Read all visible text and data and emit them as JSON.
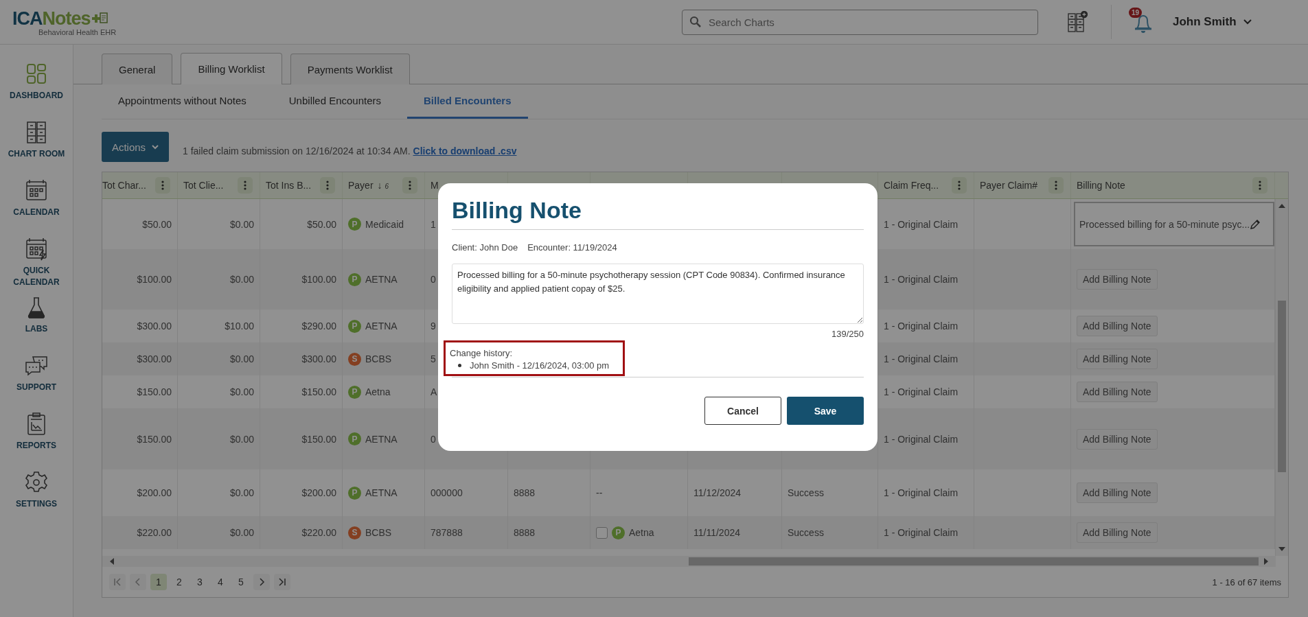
{
  "header": {
    "logo": {
      "main": "ICA",
      "accent": "Notes",
      "tagline": "Behavioral Health EHR"
    },
    "search": {
      "placeholder": "Search Charts"
    },
    "notifications": {
      "count": "19"
    },
    "user": {
      "name": "John Smith"
    }
  },
  "sidebar": {
    "items": [
      {
        "label": "DASHBOARD",
        "selected": true
      },
      {
        "label": "CHART ROOM",
        "selected": false
      },
      {
        "label": "CALENDAR",
        "selected": false
      },
      {
        "label": "QUICK CALENDAR",
        "selected": false
      },
      {
        "label": "LABS",
        "selected": false
      },
      {
        "label": "SUPPORT",
        "selected": false
      },
      {
        "label": "REPORTS",
        "selected": false
      },
      {
        "label": "SETTINGS",
        "selected": false
      }
    ]
  },
  "tabs": [
    {
      "label": "General",
      "selected": false
    },
    {
      "label": "Billing Worklist",
      "selected": true
    },
    {
      "label": "Payments Worklist",
      "selected": false
    }
  ],
  "subtabs": [
    {
      "label": "Appointments without Notes",
      "selected": false
    },
    {
      "label": "Unbilled Encounters",
      "selected": false
    },
    {
      "label": "Billed Encounters",
      "selected": true
    }
  ],
  "toolbar": {
    "actions": "Actions",
    "message": "1 failed claim submission on 12/16/2024 at 10:34 AM.",
    "link": "Click to download .csv"
  },
  "table": {
    "columns": [
      {
        "label": "Tot Char...",
        "menu": true
      },
      {
        "label": "Tot Clie...",
        "menu": true
      },
      {
        "label": "Tot Ins B...",
        "menu": true
      },
      {
        "label": "Payer",
        "sort": "↓",
        "sort_index": "6",
        "menu": true
      },
      {
        "label": "M",
        "menu": false
      },
      {
        "menu": false
      },
      {
        "menu": false
      },
      {
        "menu": false
      },
      {
        "menu": false
      },
      {
        "label": "Claim Freq...",
        "menu": true
      },
      {
        "label": "Payer Claim#",
        "menu": true
      },
      {
        "label": "Billing Note",
        "menu": true
      }
    ],
    "rows": [
      {
        "tot_charge": "$50.00",
        "tot_client": "$0.00",
        "tot_ins": "$50.00",
        "payer": {
          "badge": "P",
          "name": "Medicaid",
          "kind": "primary"
        },
        "column_5": "1",
        "claim_frequency": "1 - Original Claim",
        "billing_note": {
          "kind": "note",
          "text": "Processed billing for a 50-minute psyc...",
          "selected": true
        }
      },
      {
        "tot_charge": "$100.00",
        "tot_client": "$0.00",
        "tot_ins": "$100.00",
        "payer": {
          "badge": "P",
          "name": "AETNA",
          "kind": "primary"
        },
        "column_5": "0",
        "claim_frequency": "1 - Original Claim",
        "billing_note": {
          "kind": "add",
          "text": "Add Billing Note",
          "selected": false
        }
      },
      {
        "tot_charge": "$300.00",
        "tot_client": "$10.00",
        "tot_ins": "$290.00",
        "payer": {
          "badge": "P",
          "name": "AETNA",
          "kind": "primary"
        },
        "column_5": "9",
        "claim_frequency": "1 - Original Claim",
        "billing_note": {
          "kind": "add",
          "text": "Add Billing Note",
          "selected": false
        }
      },
      {
        "tot_charge": "$300.00",
        "tot_client": "$0.00",
        "tot_ins": "$300.00",
        "payer": {
          "badge": "S",
          "name": "BCBS",
          "kind": "secondary"
        },
        "column_5": "5",
        "claim_frequency": "1 - Original Claim",
        "billing_note": {
          "kind": "add",
          "text": "Add Billing Note",
          "selected": false
        }
      },
      {
        "tot_charge": "$150.00",
        "tot_client": "$0.00",
        "tot_ins": "$150.00",
        "payer": {
          "badge": "P",
          "name": "Aetna",
          "kind": "primary"
        },
        "column_5": "A",
        "claim_frequency": "1 - Original Claim",
        "billing_note": {
          "kind": "add",
          "text": "Add Billing Note",
          "selected": false
        }
      },
      {
        "tot_charge": "$150.00",
        "tot_client": "$0.00",
        "tot_ins": "$150.00",
        "payer": {
          "badge": "P",
          "name": "AETNA",
          "kind": "primary"
        },
        "column_5": "0",
        "claim_frequency": "1 - Original Claim",
        "billing_note": {
          "kind": "add",
          "text": "Add Billing Note",
          "selected": false
        }
      },
      {
        "tot_charge": "$200.00",
        "tot_client": "$0.00",
        "tot_ins": "$200.00",
        "payer": {
          "badge": "P",
          "name": "AETNA",
          "kind": "primary"
        },
        "column_5": "000000",
        "column_6": "8888",
        "column_7": {
          "kind": "text",
          "text": "--"
        },
        "column_8": "11/12/2024",
        "column_9": "Success",
        "claim_frequency": "1 - Original Claim",
        "billing_note": {
          "kind": "add",
          "text": "Add Billing Note",
          "selected": false
        }
      },
      {
        "tot_charge": "$220.00",
        "tot_client": "$0.00",
        "tot_ins": "$220.00",
        "payer": {
          "badge": "S",
          "name": "BCBS",
          "kind": "secondary"
        },
        "column_5": "787888",
        "column_6": "8888",
        "column_7": {
          "kind": "payer_check",
          "checked": false,
          "payer": {
            "badge": "P",
            "name": "Aetna",
            "kind": "primary"
          }
        },
        "column_8": "11/11/2024",
        "column_9": "Success",
        "claim_frequency": "1 - Original Claim",
        "billing_note": {
          "kind": "add",
          "text": "Add Billing Note",
          "selected": false
        }
      }
    ],
    "pagination": {
      "pages": [
        {
          "label": "1",
          "selected": true
        },
        {
          "label": "2",
          "selected": false
        },
        {
          "label": "3",
          "selected": false
        },
        {
          "label": "4",
          "selected": false
        },
        {
          "label": "5",
          "selected": false
        }
      ],
      "summary": "1 - 16 of 67 items"
    }
  },
  "dialog": {
    "title": "Billing Note",
    "client": "Client: John Doe",
    "encounter": "Encounter: 11/19/2024",
    "note": "Processed billing for a 50-minute psychotherapy session (CPT Code 90834). Confirmed insurance eligibility and applied patient copay of $25.",
    "counter": "139/250",
    "history_label": "Change history:",
    "history": [
      "John Smith - 12/16/2024, 03:00 pm"
    ],
    "buttons": [
      {
        "label": "Cancel",
        "kind": "secondary"
      },
      {
        "label": "Save",
        "kind": "primary"
      }
    ]
  }
}
